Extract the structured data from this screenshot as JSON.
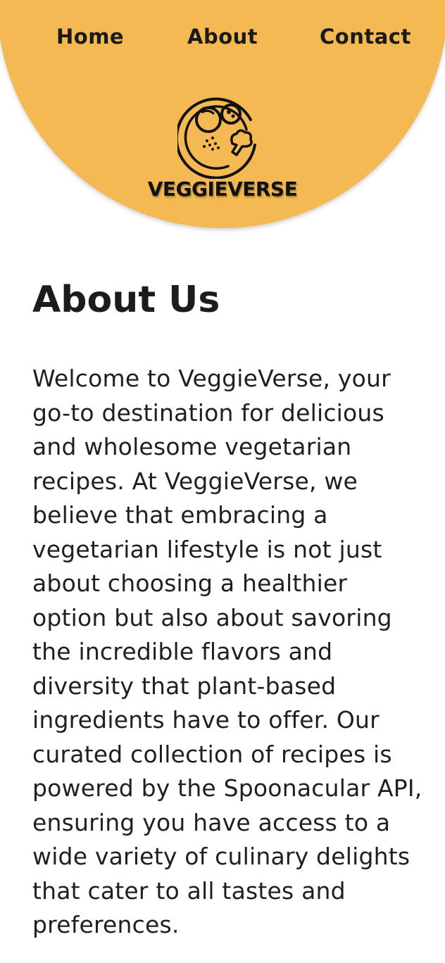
{
  "nav": {
    "home_label": "Home",
    "about_label": "About",
    "contact_label": "Contact"
  },
  "brand": {
    "name": "VEGGIEVERSE",
    "logo_icon": "veggie-plate-icon",
    "header_color": "#F4B953"
  },
  "main": {
    "title": "About Us",
    "description": "Welcome to VeggieVerse, your go-to destination for delicious and wholesome vegetarian recipes. At VeggieVerse, we believe that embracing a vegetarian lifestyle is not just about choosing a healthier option but also about savoring the incredible flavors and diversity that plant-based ingredients have to offer. Our curated collection of recipes is powered by the Spoonacular API, ensuring you have access to a wide variety of culinary delights that cater to all tastes and preferences."
  }
}
